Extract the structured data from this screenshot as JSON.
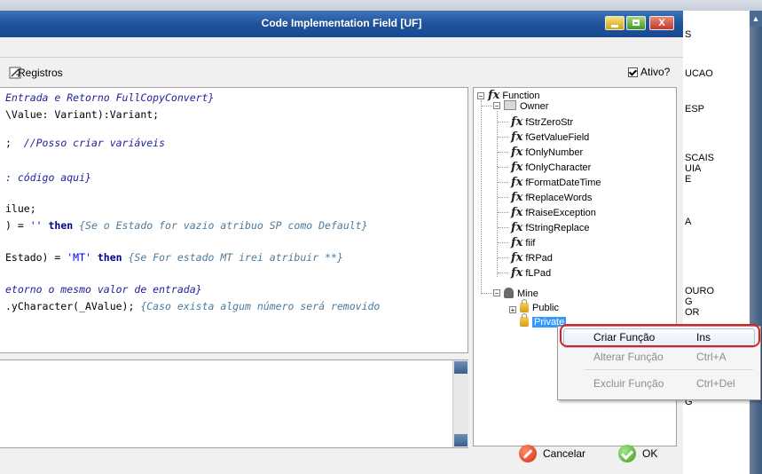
{
  "window": {
    "title": "Code Implementation Field [UF]",
    "close_label": "X"
  },
  "toolbar": {
    "registros_label": "Registros",
    "ativo_label": "Ativo?",
    "ativo_checked": true
  },
  "background": {
    "right_labels": [
      "S",
      "UCAO",
      "ESP",
      "SCAIS",
      "UIA",
      "E",
      "A",
      "OURO",
      "G",
      "OR",
      "G"
    ]
  },
  "editor": {
    "lines": [
      {
        "parts": [
          {
            "t": "Entrada e Retorno FullCopyConvert}",
            "c": "cm"
          }
        ]
      },
      {
        "parts": [
          {
            "t": "\\Value: Variant):Variant;",
            "c": ""
          }
        ]
      },
      {
        "parts": [
          {
            "t": ";  ",
            "c": ""
          },
          {
            "t": "//Posso criar variáveis",
            "c": "cm"
          }
        ]
      },
      {
        "parts": [
          {
            "t": ": código aqui}",
            "c": "cm"
          }
        ]
      },
      {
        "parts": [
          {
            "t": "ilue;",
            "c": ""
          }
        ]
      },
      {
        "parts": [
          {
            "t": ") = ",
            "c": ""
          },
          {
            "t": "''",
            "c": "str"
          },
          {
            "t": " then ",
            "c": "kw"
          },
          {
            "t": "{Se o Estado for vazio atribuo SP como Default}",
            "c": "cm2"
          }
        ]
      },
      {
        "parts": [
          {
            "t": "Estado) = ",
            "c": ""
          },
          {
            "t": "'MT'",
            "c": "str"
          },
          {
            "t": " then ",
            "c": "kw"
          },
          {
            "t": "{Se For estado MT irei atribuir **}",
            "c": "cm2"
          }
        ]
      },
      {
        "parts": [
          {
            "t": "etorno o mesmo valor de entrada}",
            "c": "cm"
          }
        ]
      },
      {
        "parts": [
          {
            "t": ".yCharacter(_AValue); ",
            "c": ""
          },
          {
            "t": "{Caso exista algum número será removido",
            "c": "cm2"
          }
        ]
      }
    ]
  },
  "tree": {
    "root": "Function",
    "owner": "Owner",
    "functions": [
      "fStrZeroStr",
      "fGetValueField",
      "fOnlyNumber",
      "fOnlyCharacter",
      "fFormatDateTime",
      "fReplaceWords",
      "fRaiseException",
      "fStringReplace",
      "fiif",
      "fRPad",
      "fLPad"
    ],
    "mine": "Mine",
    "public": "Public",
    "private": "Private"
  },
  "context_menu": {
    "items": [
      {
        "label": "Criar Função",
        "shortcut": "Ins",
        "enabled": true
      },
      {
        "label": "Alterar Função",
        "shortcut": "Ctrl+A",
        "enabled": false
      },
      {
        "label": "Excluir Função",
        "shortcut": "Ctrl+Del",
        "enabled": false
      }
    ]
  },
  "footer": {
    "cancel_label": "Cancelar",
    "ok_label": "OK"
  }
}
